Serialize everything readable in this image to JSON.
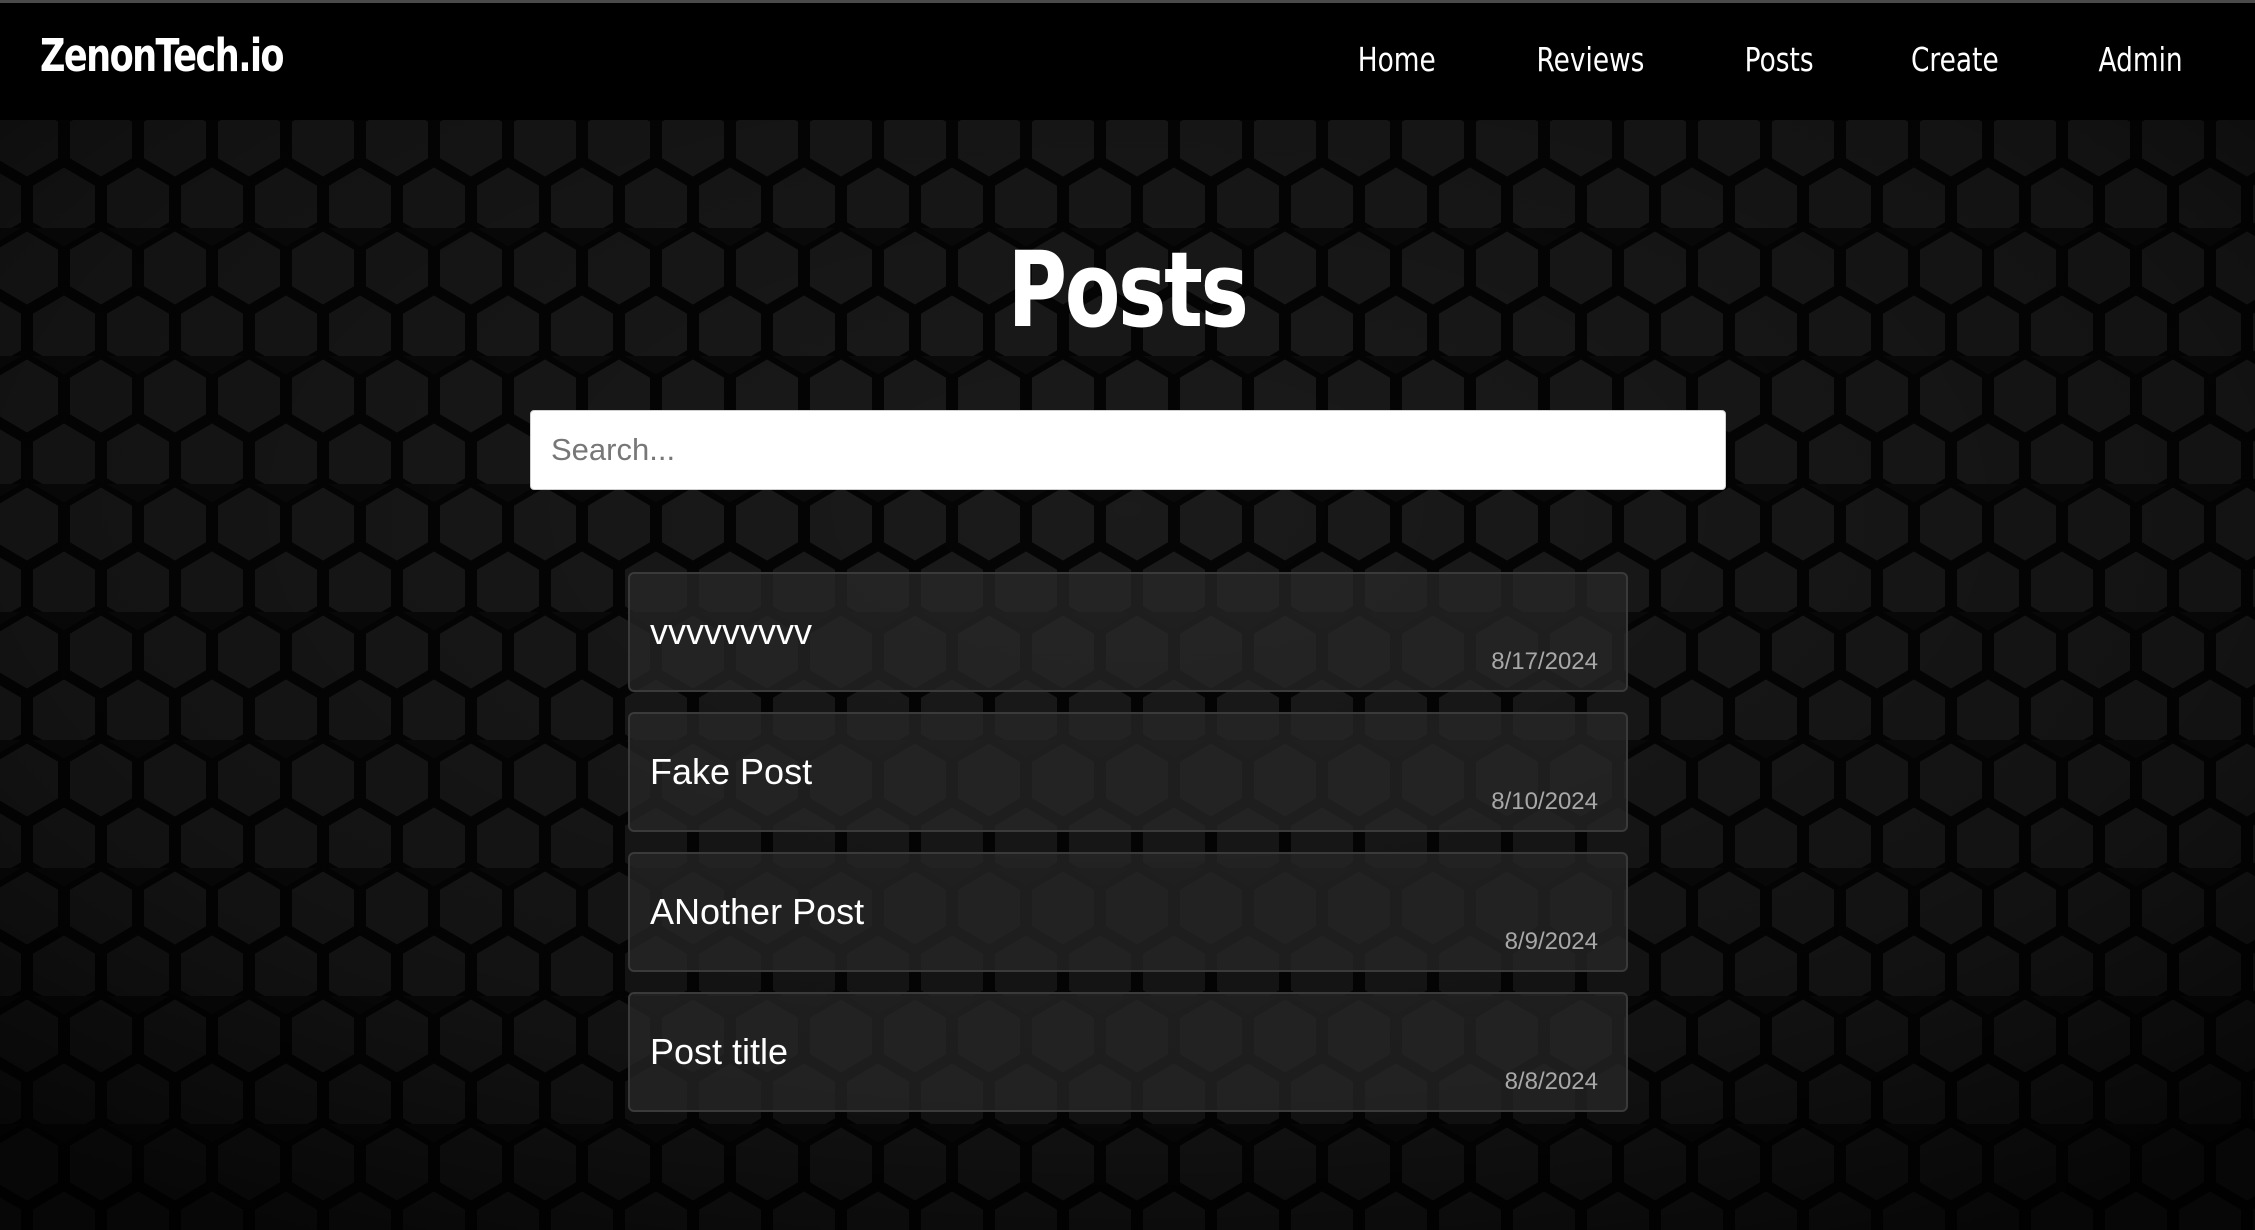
{
  "brand": "ZenonTech.io",
  "nav": {
    "items": [
      {
        "label": "Home"
      },
      {
        "label": "Reviews"
      },
      {
        "label": "Posts"
      },
      {
        "label": "Create"
      },
      {
        "label": "Admin"
      }
    ]
  },
  "main": {
    "title": "Posts",
    "search": {
      "placeholder": "Search...",
      "value": ""
    },
    "posts": [
      {
        "title": "vvvvvvvvv",
        "date": "8/17/2024"
      },
      {
        "title": "Fake Post",
        "date": "8/10/2024"
      },
      {
        "title": "ANother Post",
        "date": "8/9/2024"
      },
      {
        "title": "Post title",
        "date": "8/8/2024"
      }
    ]
  },
  "colors": {
    "background": "#0b0b0b",
    "navbar": "#000000",
    "card_border": "#3a3a3a",
    "date_text": "#a8a8a8",
    "hex_fill": "#1c1c1c",
    "hex_stroke": "#050505"
  },
  "background_pattern": "hexagon-honeycomb"
}
